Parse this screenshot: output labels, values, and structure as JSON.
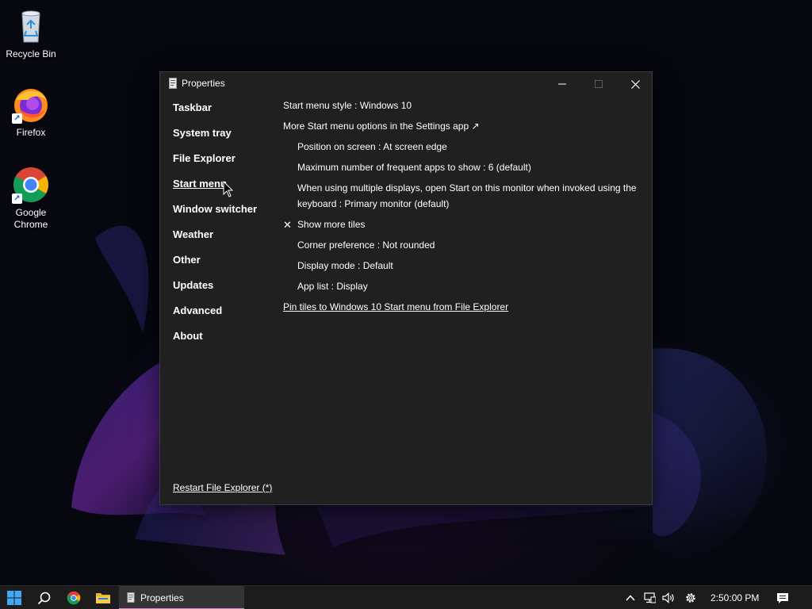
{
  "desktop": {
    "icons": [
      {
        "label": "Recycle Bin",
        "icon": "recycle-bin-icon"
      },
      {
        "label": "Firefox",
        "icon": "firefox-icon"
      },
      {
        "label_line1": "Google",
        "label_line2": "Chrome",
        "icon": "chrome-icon"
      }
    ]
  },
  "window": {
    "title": "Properties",
    "controls": {
      "minimize": "minimize-icon",
      "maximize": "maximize-icon",
      "close": "close-icon"
    },
    "sidebar": [
      {
        "label": "Taskbar"
      },
      {
        "label": "System tray"
      },
      {
        "label": "File Explorer"
      },
      {
        "label": "Start menu",
        "active": true
      },
      {
        "label": "Window switcher"
      },
      {
        "label": "Weather"
      },
      {
        "label": "Other"
      },
      {
        "label": "Updates"
      },
      {
        "label": "Advanced"
      },
      {
        "label": "About"
      }
    ],
    "content": {
      "start_menu_style": "Start menu style : Windows 10",
      "more_options": "More Start menu options in the Settings app ↗",
      "position": "Position on screen : At screen edge",
      "max_frequent": "Maximum number of frequent apps to show : 6 (default)",
      "multi_display": "When using multiple displays, open Start on this monitor when invoked using the keyboard : Primary monitor (default)",
      "show_more_tiles": "Show more tiles",
      "show_more_tiles_checked": "✕",
      "corner_pref": "Corner preference : Not rounded",
      "display_mode": "Display mode : Default",
      "app_list": "App list : Display",
      "pin_tiles": "Pin tiles to Windows 10 Start menu from File Explorer"
    },
    "restart": "Restart File Explorer (*)"
  },
  "taskbar": {
    "start": "windows-start-icon",
    "search": "search-icon",
    "pinned": [
      "chrome-icon",
      "file-explorer-icon"
    ],
    "task_label": "Properties",
    "tray": [
      "chevron-up-icon",
      "network-icon",
      "volume-icon",
      "gear-icon"
    ],
    "clock": "2:50:00 PM",
    "notifications": "notification-icon"
  },
  "colors": {
    "window_bg": "#202020",
    "taskbar_bg": "#1c1c1c",
    "task_underline": "#e07fd7"
  }
}
